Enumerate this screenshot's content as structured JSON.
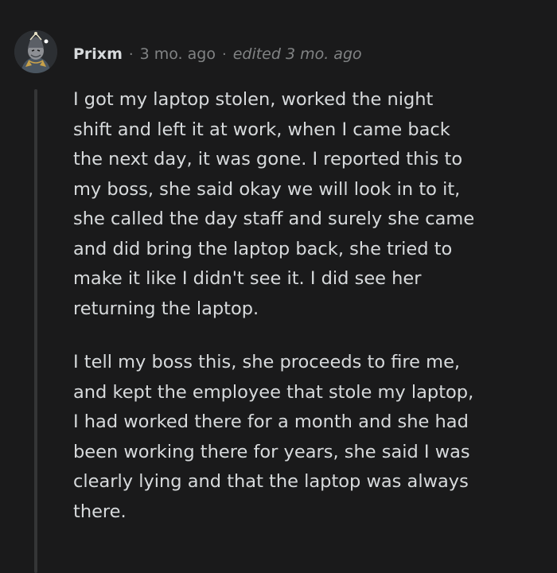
{
  "comment": {
    "author": "Prixm",
    "separator": "·",
    "timestamp": "3 mo. ago",
    "edited": "edited 3 mo. ago",
    "paragraphs": [
      "I got my laptop stolen, worked the night\nshift and left it at work, when I came back\nthe next day, it was gone. I reported this to\nmy boss, she said okay we will look in to it,\nshe called the day staff and surely she came\nand did bring the laptop back, she tried to\nmake it like I didn't see it. I did see her\nreturning the laptop.",
      "I tell my boss this, she proceeds to fire me,\nand kept the employee that stole my laptop,\nI had worked there for a month and she had\nbeen working there for years, she said I was\nclearly lying and that the laptop was always\nthere."
    ]
  },
  "colors": {
    "background": "#1a1a1b",
    "text": "#d7dadc",
    "meta": "#818384",
    "thread_line": "#343536"
  },
  "icons": {
    "avatar": "user-avatar-icon"
  }
}
